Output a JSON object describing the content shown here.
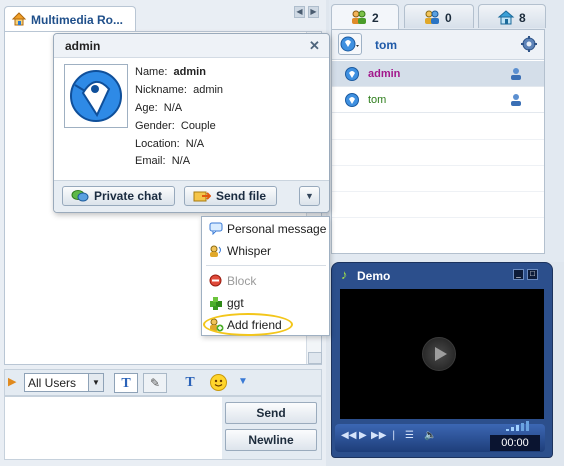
{
  "room_tab": {
    "title": "Multimedia Ro..."
  },
  "chat": {
    "audience": "All Users",
    "send_label": "Send",
    "newline_label": "Newline"
  },
  "user_tabs": [
    {
      "count": "2",
      "icon": "users-icon"
    },
    {
      "count": "0",
      "icon": "room-users-icon"
    },
    {
      "count": "8",
      "icon": "home-icon"
    }
  ],
  "users_panel": {
    "self_name": "tom"
  },
  "users": [
    {
      "name": "admin",
      "color": "#a2178b"
    },
    {
      "name": "tom",
      "color": "#2c7d1a"
    }
  ],
  "profile": {
    "username": "admin",
    "fields": [
      {
        "label": "Name:",
        "value": "admin"
      },
      {
        "label": "Nickname:",
        "value": "admin"
      },
      {
        "label": "Age:",
        "value": "N/A"
      },
      {
        "label": "Gender:",
        "value": "Couple"
      },
      {
        "label": "Location:",
        "value": "N/A"
      },
      {
        "label": "Email:",
        "value": "N/A"
      }
    ],
    "private_chat_label": "Private chat",
    "send_file_label": "Send file"
  },
  "menu": {
    "items": [
      {
        "label": "Personal message",
        "enabled": true
      },
      {
        "label": "Whisper",
        "enabled": true
      },
      {
        "label": "Block",
        "enabled": false
      },
      {
        "label": "ggt",
        "enabled": true
      },
      {
        "label": "Add friend",
        "enabled": true,
        "highlighted": true
      }
    ]
  },
  "player": {
    "title": "Demo",
    "time": "00:00"
  }
}
